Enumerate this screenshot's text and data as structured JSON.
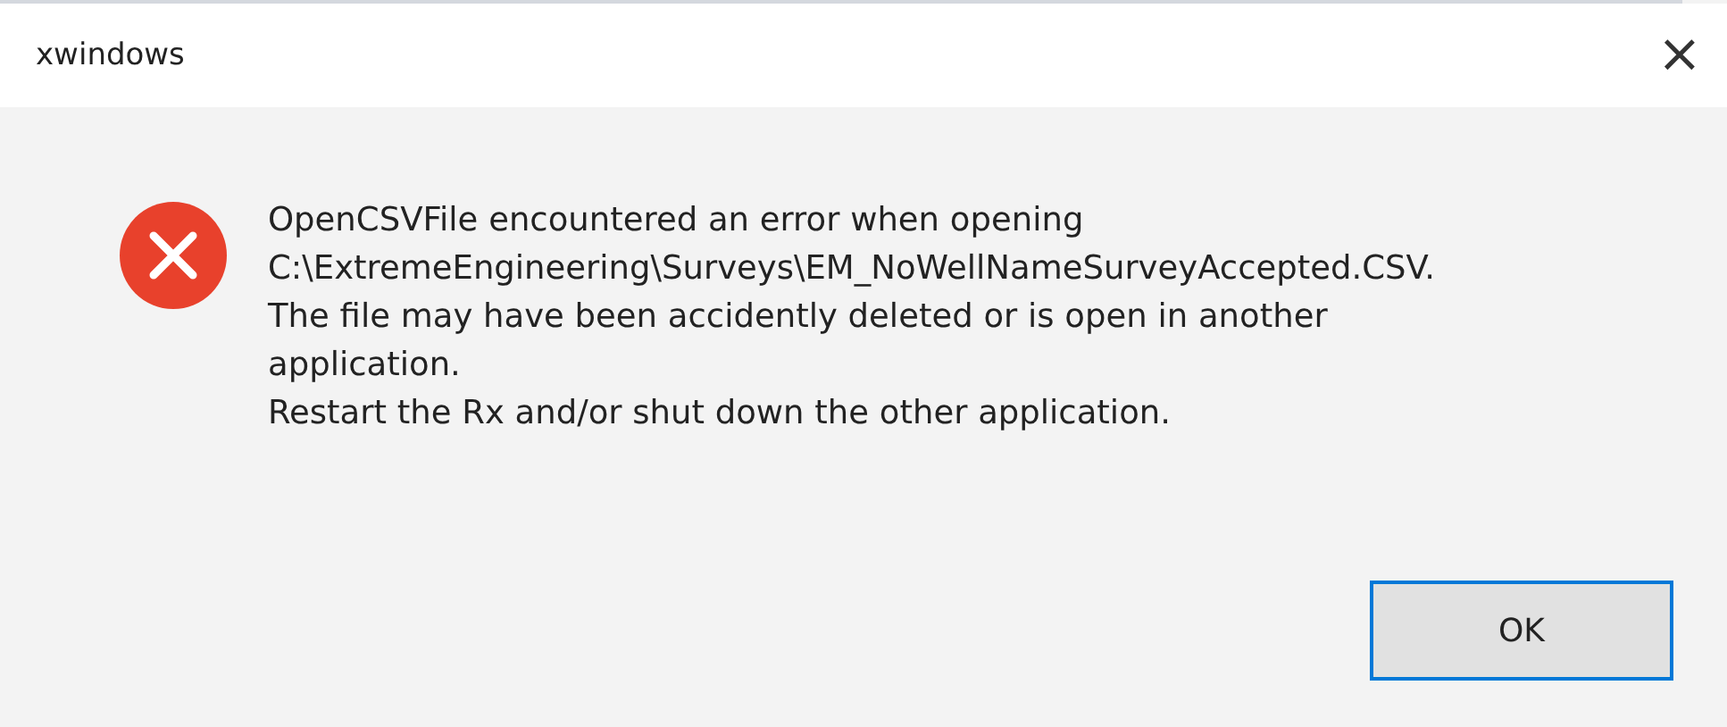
{
  "window": {
    "title": "xwindows",
    "close": "×"
  },
  "message": {
    "lines": [
      "OpenCSVFile encountered an error when opening",
      "C:\\ExtremeEngineering\\Surveys\\EM_NoWellNameSurveyAccepted.CSV.",
      "The file may have been accidently deleted or is open in another",
      "application.",
      "Restart the Rx and/or shut down the other application."
    ]
  },
  "buttons": [
    {
      "label": "OK",
      "selected": true
    }
  ]
}
